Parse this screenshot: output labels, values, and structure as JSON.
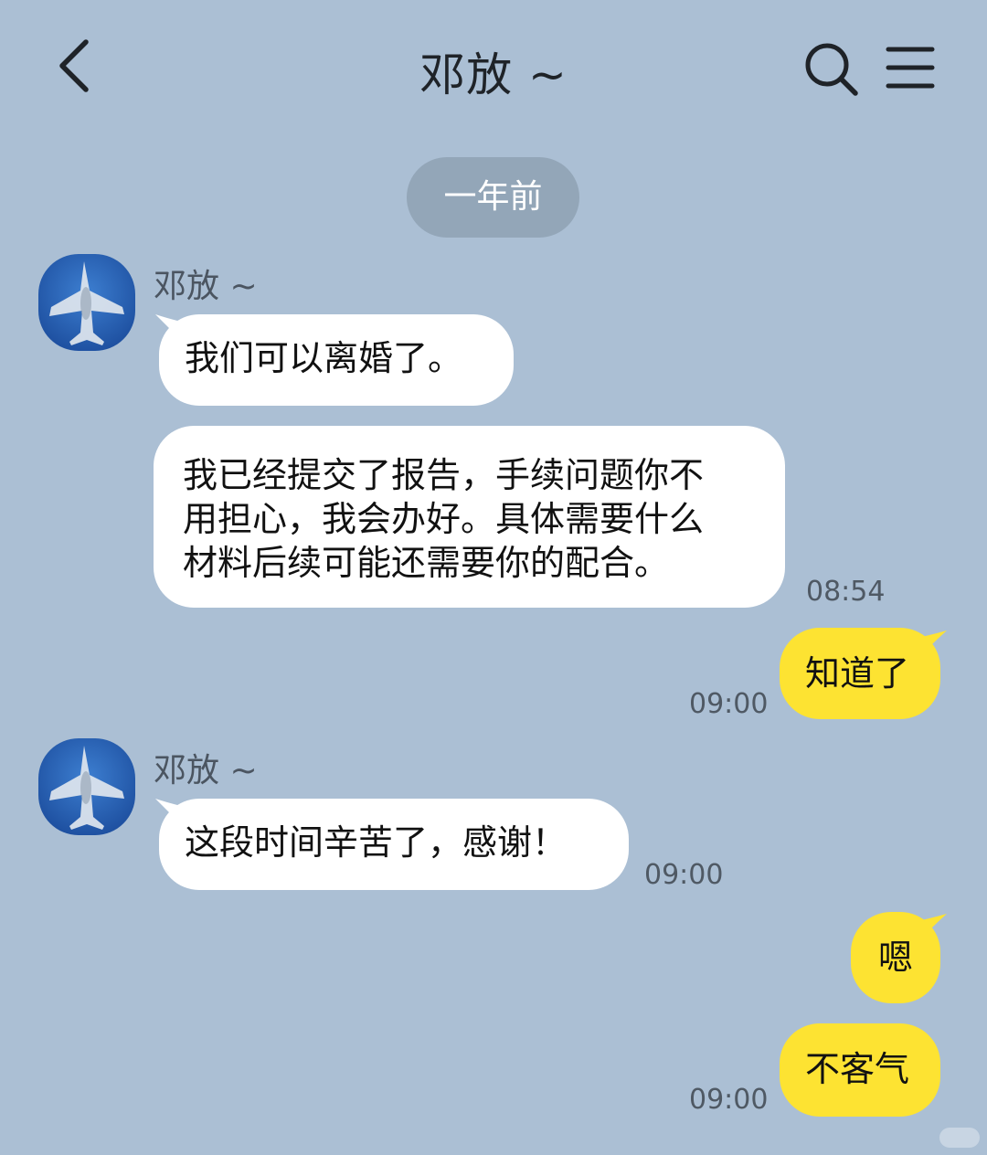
{
  "header": {
    "title": "邓放 ~"
  },
  "divider": {
    "label": "一年前"
  },
  "messages": [
    {
      "sender": "邓放 ~",
      "text": "我们可以离婚了。"
    },
    {
      "lines": [
        "我已经提交了报告，手续问题你不",
        "用担心，我会办好。具体需要什么",
        "材料后续可能还需要你的配合。"
      ],
      "time": "08:54"
    },
    {
      "text": "知道了",
      "time": "09:00"
    },
    {
      "sender": "邓放 ~",
      "text": "这段时间辛苦了，感谢！",
      "time": "09:00"
    },
    {
      "text": "嗯"
    },
    {
      "text": "不客气",
      "time": "09:00"
    }
  ],
  "colors": {
    "background": "#abbfd4",
    "incoming_bubble": "#ffffff",
    "outgoing_bubble": "#fde332",
    "divider": "#93a6b8"
  },
  "icons": {
    "back": "chevron-left-icon",
    "search": "search-icon",
    "menu": "menu-icon"
  }
}
